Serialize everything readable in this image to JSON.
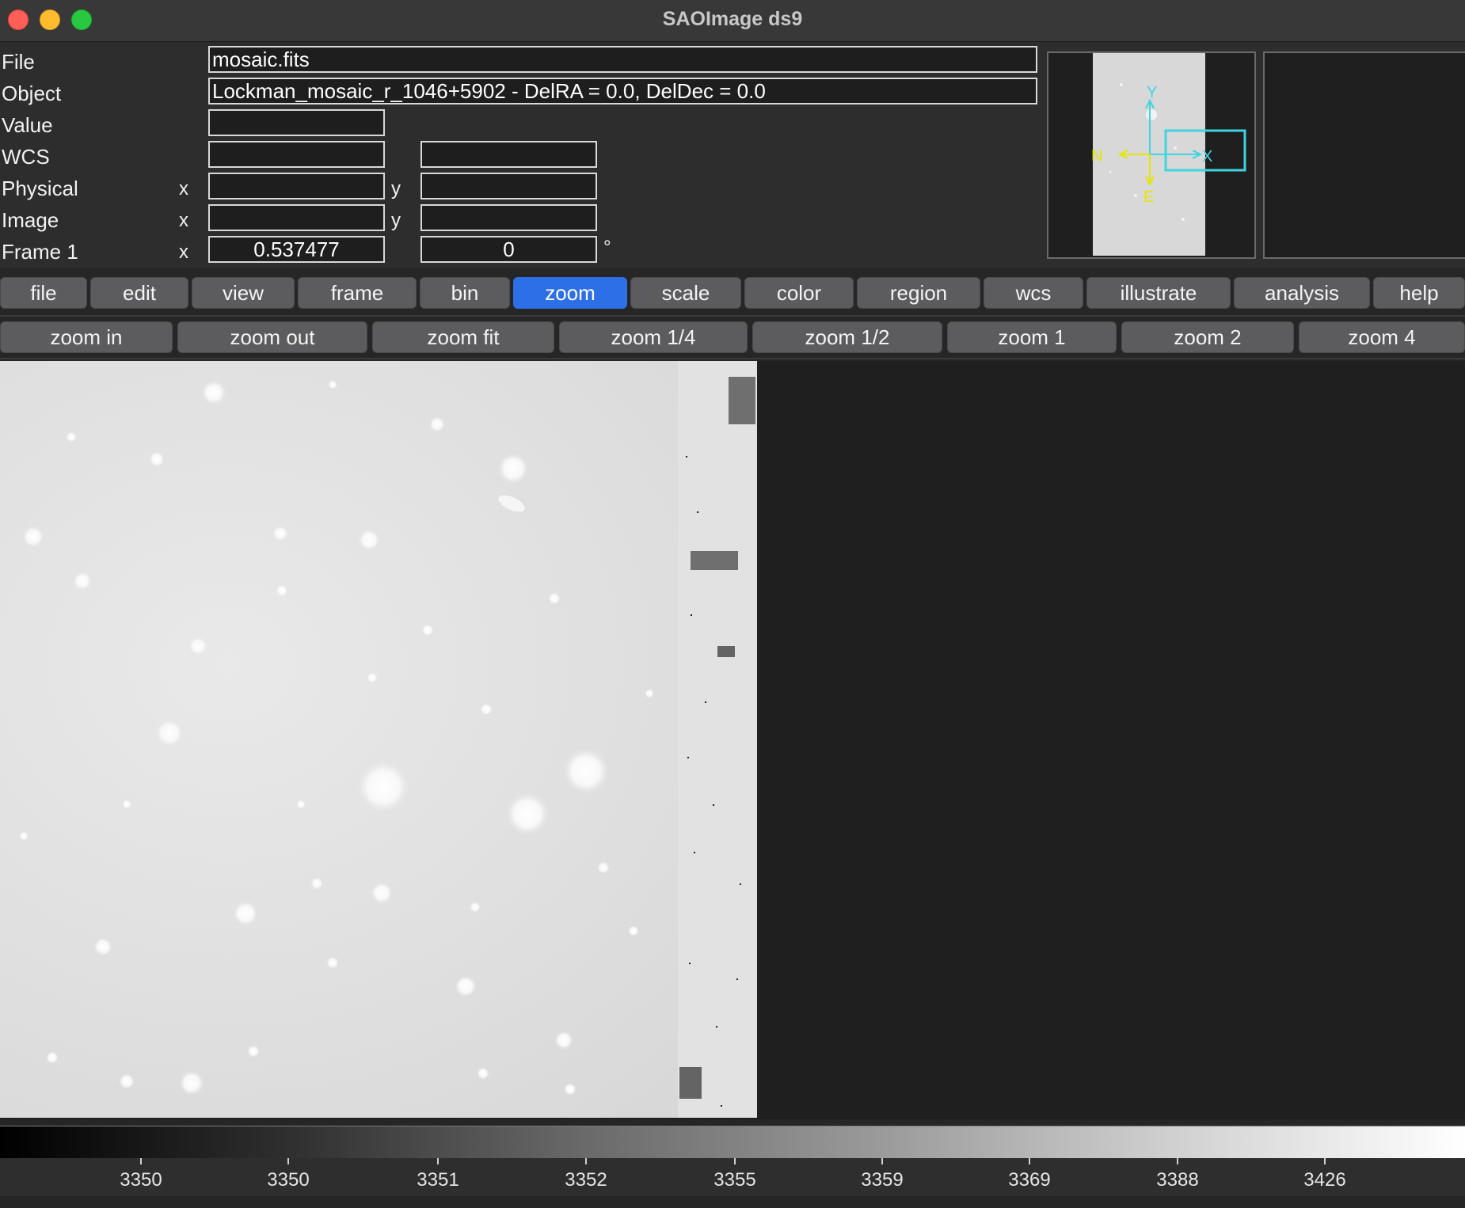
{
  "window": {
    "title": "SAOImage ds9"
  },
  "info": {
    "labels": {
      "file": "File",
      "object": "Object",
      "value": "Value",
      "wcs": "WCS",
      "physical": "Physical",
      "image": "Image",
      "frame": "Frame 1"
    },
    "axis": {
      "x": "x",
      "y": "y",
      "degree": "°"
    },
    "file_value": "mosaic.fits",
    "object_value": "Lockman_mosaic_r_1046+5902 - DelRA =   0.0, DelDec =   0.0",
    "value_value": "",
    "wcs_1": "",
    "wcs_2": "",
    "physical_x": "",
    "physical_y": "",
    "image_x": "",
    "image_y": "",
    "frame_zoom": "0.537477",
    "frame_angle": "0"
  },
  "panner": {
    "compass": {
      "n": "N",
      "e": "E",
      "x": "X",
      "y": "Y"
    },
    "colors": {
      "compass_wcs": "#e6e600",
      "compass_image": "#3ed4e0",
      "view_box": "#3ed4e0"
    }
  },
  "menu": [
    {
      "label": "file",
      "active": false
    },
    {
      "label": "edit",
      "active": false
    },
    {
      "label": "view",
      "active": false
    },
    {
      "label": "frame",
      "active": false
    },
    {
      "label": "bin",
      "active": false
    },
    {
      "label": "zoom",
      "active": true
    },
    {
      "label": "scale",
      "active": false
    },
    {
      "label": "color",
      "active": false
    },
    {
      "label": "region",
      "active": false
    },
    {
      "label": "wcs",
      "active": false
    },
    {
      "label": "illustrate",
      "active": false
    },
    {
      "label": "analysis",
      "active": false
    },
    {
      "label": "help",
      "active": false
    }
  ],
  "zoom_buttons": [
    "zoom in",
    "zoom out",
    "zoom fit",
    "zoom 1/4",
    "zoom 1/2",
    "zoom 1",
    "zoom 2",
    "zoom 4"
  ],
  "colorbar": {
    "ticks": [
      "3350",
      "3350",
      "3351",
      "3352",
      "3355",
      "3359",
      "3369",
      "3388",
      "3426"
    ]
  },
  "colors": {
    "accent": "#2d6fe6"
  }
}
